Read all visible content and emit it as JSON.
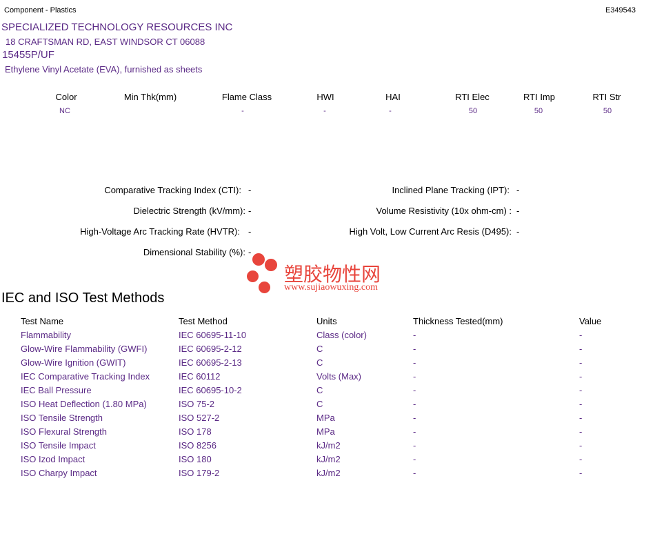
{
  "header": {
    "category": "Component - Plastics",
    "file_number": "E349543"
  },
  "company": {
    "name": "SPECIALIZED TECHNOLOGY RESOURCES INC",
    "address": "18 CRAFTSMAN RD, EAST WINDSOR CT   06088",
    "part_number": "15455P/UF",
    "description": "Ethylene Vinyl Acetate (EVA), furnished as sheets"
  },
  "ratings": {
    "headers": [
      "Color",
      "Min Thk(mm)",
      "Flame Class",
      "HWI",
      "HAI",
      "RTI Elec",
      "RTI Imp",
      "RTI Str"
    ],
    "values": [
      "NC",
      "",
      "-",
      "-",
      "-",
      "50",
      "50",
      "50"
    ]
  },
  "properties": {
    "left": [
      {
        "label": "Comparative Tracking Index (CTI):",
        "value": "-"
      },
      {
        "label": "Dielectric Strength (kV/mm):",
        "value": "-"
      },
      {
        "label": "High-Voltage Arc Tracking Rate (HVTR):",
        "value": "-"
      },
      {
        "label": "Dimensional Stability (%):",
        "value": "-"
      }
    ],
    "right": [
      {
        "label": "Inclined Plane Tracking (IPT):",
        "value": "-"
      },
      {
        "label": "Volume Resistivity (10x ohm-cm) :",
        "value": "-"
      },
      {
        "label": "High Volt, Low Current Arc Resis (D495):",
        "value": "-"
      }
    ]
  },
  "watermark": {
    "chinese": "塑胶物性网",
    "url": "www.sujiaowuxing.com"
  },
  "test_methods": {
    "title": "IEC and ISO Test Methods",
    "headers": [
      "Test Name",
      "Test Method",
      "Units",
      "Thickness Tested(mm)",
      "Value"
    ],
    "rows": [
      [
        "Flammability",
        "IEC 60695-11-10",
        "Class (color)",
        "-",
        "-"
      ],
      [
        "Glow-Wire Flammability (GWFI)",
        "IEC 60695-2-12",
        "C",
        "-",
        "-"
      ],
      [
        "Glow-Wire Ignition (GWIT)",
        "IEC 60695-2-13",
        "C",
        "-",
        "-"
      ],
      [
        "IEC Comparative Tracking Index",
        "IEC 60112",
        "Volts (Max)",
        "-",
        "-"
      ],
      [
        "IEC Ball Pressure",
        "IEC 60695-10-2",
        "C",
        "-",
        "-"
      ],
      [
        "ISO Heat Deflection (1.80 MPa)",
        "ISO 75-2",
        "C",
        "-",
        "-"
      ],
      [
        "ISO Tensile Strength",
        "ISO 527-2",
        "MPa",
        "-",
        "-"
      ],
      [
        "ISO Flexural Strength",
        "ISO 178",
        "MPa",
        "-",
        "-"
      ],
      [
        "ISO Tensile Impact",
        "ISO 8256",
        "kJ/m2",
        "-",
        "-"
      ],
      [
        "ISO Izod Impact",
        "ISO 180",
        "kJ/m2",
        "-",
        "-"
      ],
      [
        "ISO Charpy Impact",
        "ISO 179-2",
        "kJ/m2",
        "-",
        "-"
      ]
    ]
  }
}
